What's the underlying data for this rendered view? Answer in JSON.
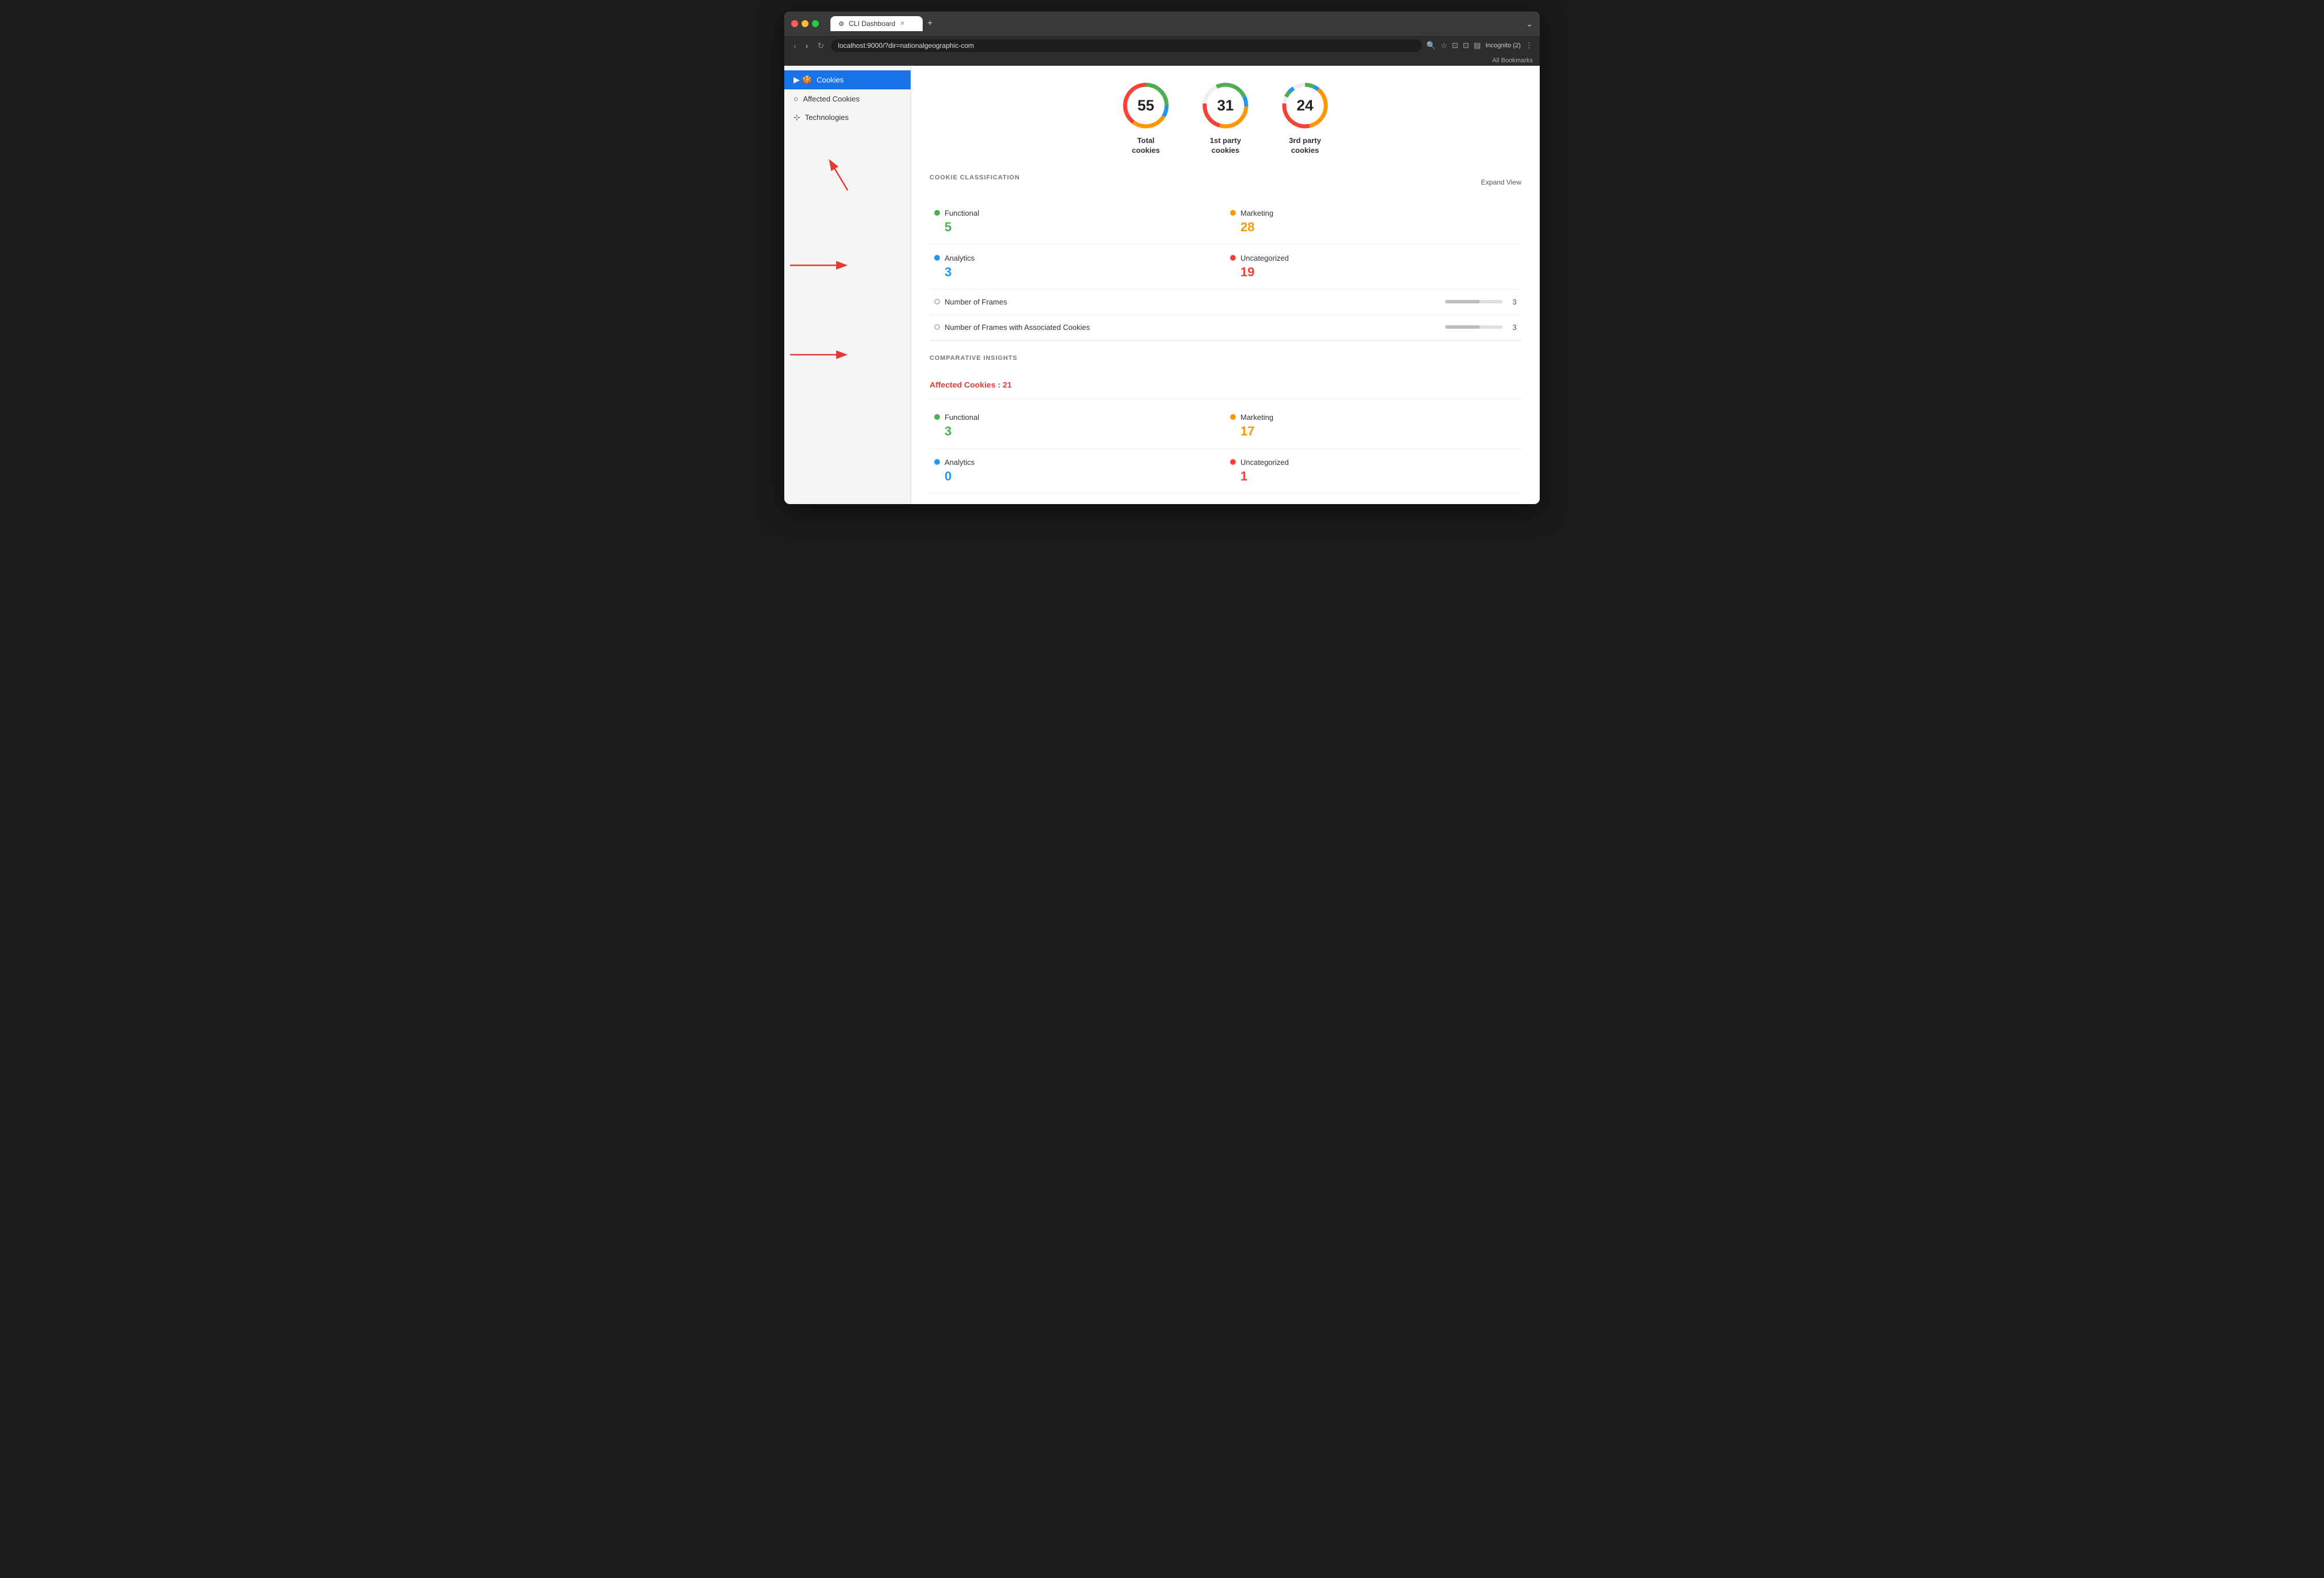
{
  "browser": {
    "tab_title": "CLI Dashboard",
    "url": "localhost:9000/?dir=nationalgeographic-com",
    "bookmarks_label": "All Bookmarks",
    "incognito_label": "Incognito (2)",
    "new_tab_symbol": "+",
    "back_symbol": "‹",
    "forward_symbol": "›",
    "refresh_symbol": "↻"
  },
  "sidebar": {
    "items": [
      {
        "id": "cookies",
        "label": "Cookies",
        "icon": "🍪",
        "active": true
      },
      {
        "id": "affected-cookies",
        "label": "Affected Cookies",
        "icon": "○"
      },
      {
        "id": "technologies",
        "label": "Technologies",
        "icon": "⊹"
      }
    ]
  },
  "stats": [
    {
      "id": "total",
      "value": "55",
      "label": "Total\ncookies",
      "colors": [
        "#4caf50",
        "#2196f3",
        "#ff9800",
        "#f44336"
      ]
    },
    {
      "id": "first-party",
      "value": "31",
      "label": "1st party\ncookies",
      "colors": [
        "#4caf50",
        "#2196f3",
        "#ff9800",
        "#f44336"
      ]
    },
    {
      "id": "third-party",
      "value": "24",
      "label": "3rd party\ncookies",
      "colors": [
        "#4caf50",
        "#2196f3",
        "#ff9800",
        "#f44336"
      ]
    }
  ],
  "cookie_classification": {
    "section_title": "COOKIE CLASSIFICATION",
    "expand_label": "Expand View",
    "items": [
      {
        "id": "functional",
        "label": "Functional",
        "count": "5",
        "color_class": "dot-green",
        "count_class": "count-green"
      },
      {
        "id": "marketing",
        "label": "Marketing",
        "count": "28",
        "color_class": "dot-orange",
        "count_class": "count-orange"
      },
      {
        "id": "analytics",
        "label": "Analytics",
        "count": "3",
        "color_class": "dot-blue",
        "count_class": "count-blue"
      },
      {
        "id": "uncategorized",
        "label": "Uncategorized",
        "count": "19",
        "color_class": "dot-red",
        "count_class": "count-red"
      }
    ],
    "frames": [
      {
        "id": "num-frames",
        "label": "Number of Frames",
        "count": "3"
      },
      {
        "id": "frames-with-cookies",
        "label": "Number of Frames with Associated Cookies",
        "count": "3"
      }
    ]
  },
  "comparative_insights": {
    "section_title": "COMPARATIVE INSIGHTS",
    "affected_label": "Affected Cookies : 21",
    "items": [
      {
        "id": "functional",
        "label": "Functional",
        "count": "3",
        "color_class": "dot-green",
        "count_class": "count-green"
      },
      {
        "id": "marketing",
        "label": "Marketing",
        "count": "17",
        "color_class": "dot-orange",
        "count_class": "count-orange"
      },
      {
        "id": "analytics",
        "label": "Analytics",
        "count": "0",
        "color_class": "dot-blue",
        "count_class": "count-blue"
      },
      {
        "id": "uncategorized",
        "label": "Uncategorized",
        "count": "1",
        "color_class": "dot-red",
        "count_class": "count-red"
      }
    ]
  }
}
